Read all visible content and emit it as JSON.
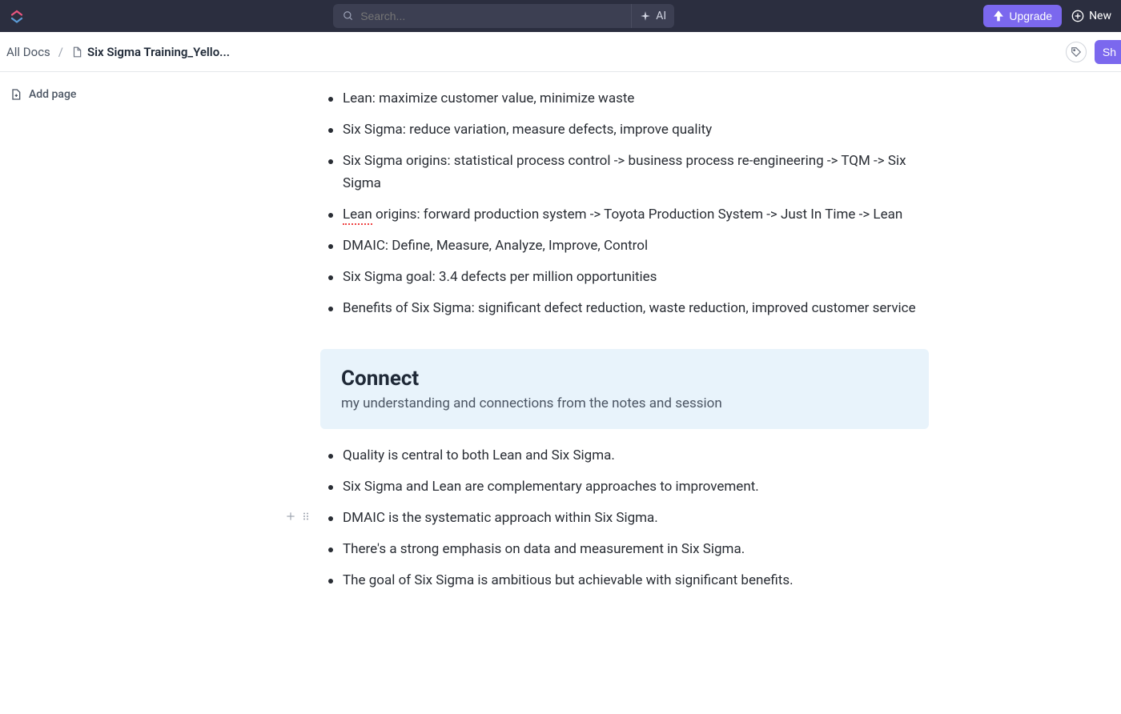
{
  "header": {
    "search_placeholder": "Search...",
    "ai_label": "AI",
    "upgrade_label": "Upgrade",
    "new_label": "New"
  },
  "breadcrumb": {
    "root": "All Docs",
    "current": "Six Sigma Training_Yello...",
    "share_label": "Sh"
  },
  "sidebar": {
    "add_page": "Add page"
  },
  "notes_list": [
    "Lean: maximize customer value, minimize waste",
    "Six Sigma: reduce variation, measure defects, improve quality",
    "Six Sigma origins: statistical process control -> business process re-engineering -> TQM -> Six Sigma",
    "",
    "DMAIC: Define, Measure, Analyze, Improve, Control",
    "Six Sigma goal: 3.4 defects per million opportunities",
    "Benefits of Six Sigma: significant defect reduction, waste reduction, improved customer service"
  ],
  "lean_origins": {
    "underlined": "Lean",
    "rest": " origins: forward production system -> Toyota Production System -> Just In Time -> Lean"
  },
  "connect": {
    "title": "Connect",
    "subtitle": "my understanding and connections from the notes and session"
  },
  "connect_list": [
    "Quality is central to both Lean and Six Sigma.",
    "Six Sigma and Lean are complementary approaches to improvement.",
    "DMAIC is the systematic approach within Six Sigma.",
    "There's a strong emphasis on data and measurement in Six Sigma.",
    "The goal of Six Sigma is ambitious but achievable with significant benefits."
  ]
}
